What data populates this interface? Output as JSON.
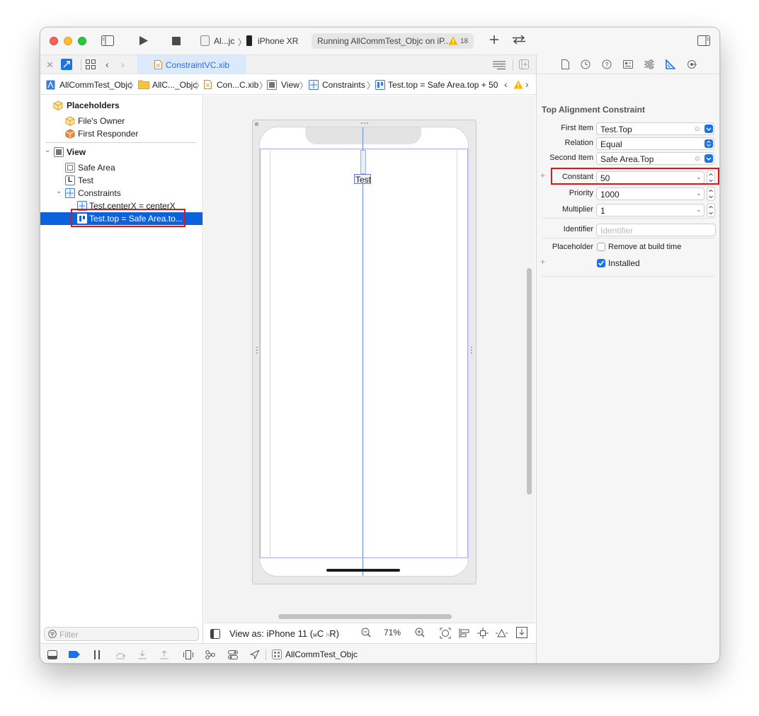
{
  "toolbar": {
    "scheme": "Al...jc",
    "device": "iPhone XR",
    "status": "Running AllCommTest_Objc on iP...",
    "warning_count": "18"
  },
  "tab": {
    "file_name": "ConstraintVC.xib"
  },
  "jumpbar": {
    "crumbs": [
      "AllCommTest_Objc",
      "AllC..._Objc",
      "Con...C.xib",
      "View",
      "Constraints",
      "Test.top = Safe Area.top + 50"
    ]
  },
  "navigator": {
    "placeholders": "Placeholders",
    "files_owner": "File's Owner",
    "first_responder": "First Responder",
    "view": "View",
    "safe_area": "Safe Area",
    "test": "Test",
    "constraints": "Constraints",
    "constraint_1": "Test.centerX = centerX",
    "constraint_2": "Test.top = Safe Area.to...",
    "filter_placeholder": "Filter",
    "test_label_icon": "L"
  },
  "canvas": {
    "label_text": "Test",
    "view_as": "View as: iPhone 11 (",
    "size_class_w": "w",
    "size_class_wc": "C",
    "size_class_h": "h",
    "size_class_hr": "R)",
    "zoom": "71%"
  },
  "debugbar": {
    "target": "AllCommTest_Objc"
  },
  "inspector": {
    "title": "Top Alignment Constraint",
    "first_item_label": "First Item",
    "first_item_value": "Test.Top",
    "relation_label": "Relation",
    "relation_value": "Equal",
    "second_item_label": "Second Item",
    "second_item_value": "Safe Area.Top",
    "constant_label": "Constant",
    "constant_value": "50",
    "priority_label": "Priority",
    "priority_value": "1000",
    "multiplier_label": "Multiplier",
    "multiplier_value": "1",
    "identifier_label": "Identifier",
    "identifier_placeholder": "Identifier",
    "placeholder_label": "Placeholder",
    "remove_at_build": "Remove at build time",
    "installed": "Installed"
  },
  "colors": {
    "accent": "#0a63dd",
    "highlight": "#e01616"
  }
}
